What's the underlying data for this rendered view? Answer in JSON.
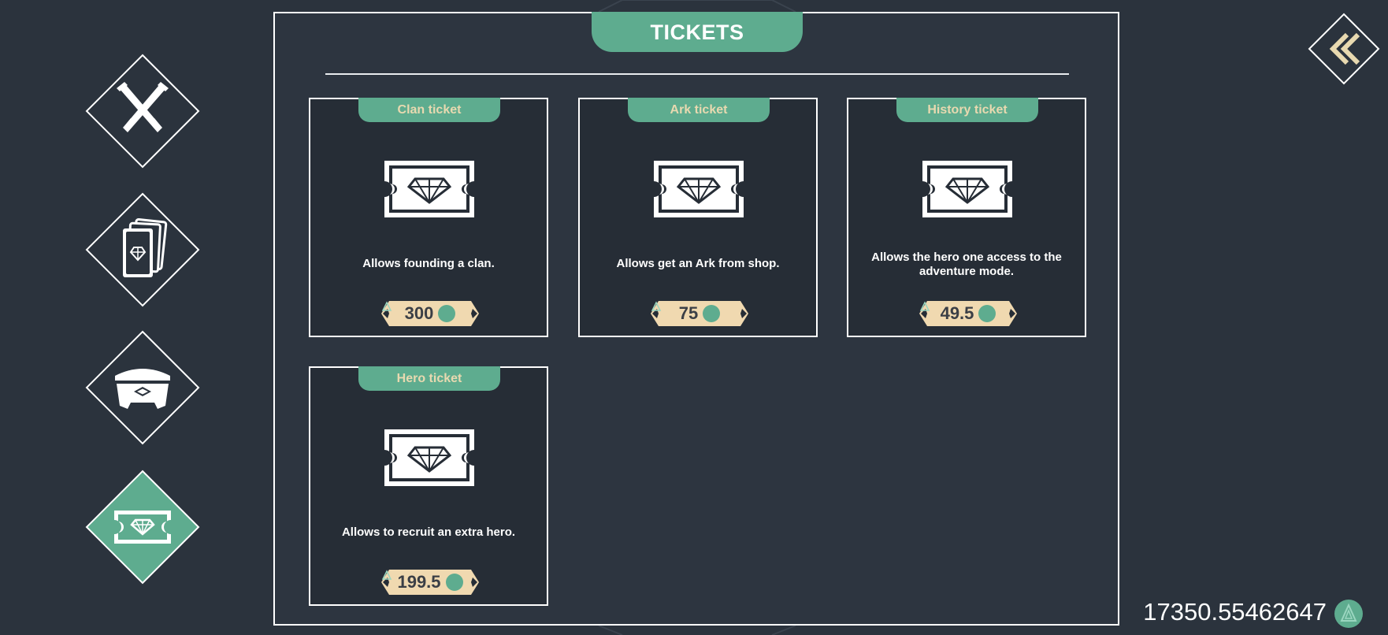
{
  "header": {
    "title": "TICKETS"
  },
  "nav": {
    "items": [
      {
        "name": "battle",
        "icon": "crossed-swords-icon",
        "active": false
      },
      {
        "name": "cards",
        "icon": "cards-icon",
        "active": false
      },
      {
        "name": "chest",
        "icon": "chest-icon",
        "active": false
      },
      {
        "name": "tickets",
        "icon": "ticket-icon",
        "active": true
      }
    ],
    "back_icon": "double-chevron-left-icon"
  },
  "tickets": [
    {
      "title": "Clan ticket",
      "description": "Allows founding a clan.",
      "price": "300"
    },
    {
      "title": "Ark ticket",
      "description": "Allows get an Ark from shop.",
      "price": "75"
    },
    {
      "title": "History ticket",
      "description": "Allows the hero one access to the adventure mode.",
      "price": "49.5"
    },
    {
      "title": "Hero ticket",
      "description": "Allows to recruit an extra hero.",
      "price": "199.5"
    }
  ],
  "wallet": {
    "balance": "17350.55462647",
    "currency_icon": "coin-icon"
  },
  "colors": {
    "background": "#2b333d",
    "accent": "#5eac8f",
    "gold": "#e8d9b0",
    "price_tag": "#f0d9b0"
  }
}
